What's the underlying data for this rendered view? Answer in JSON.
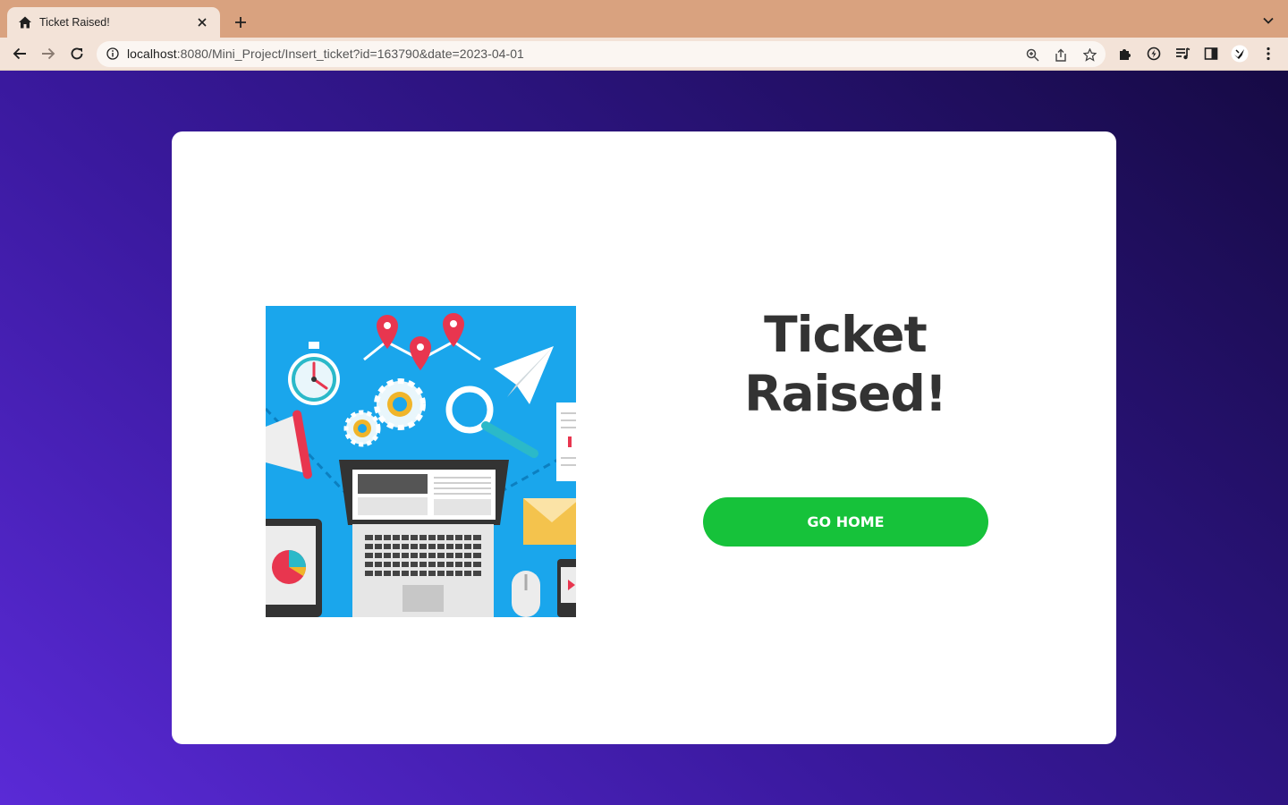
{
  "browser": {
    "tab_title": "Ticket Raised!",
    "url_host": "localhost",
    "url_rest": ":8080/Mini_Project/Insert_ticket?id=163790&date=2023-04-01"
  },
  "page": {
    "heading_line1": "Ticket",
    "heading_line2": "Raised!",
    "go_home_label": "GO HOME"
  },
  "colors": {
    "tab_strip": "#d9a27f",
    "toolbar": "#f3e3d8",
    "background_gradient_start": "#5a2ad6",
    "background_gradient_end": "#160a44",
    "button": "#16c23a",
    "heading": "#333333",
    "illustration_bg": "#1aa6ec"
  },
  "icons": {
    "favicon": "home-icon",
    "toolbar": [
      "back-arrow-icon",
      "forward-arrow-icon",
      "reload-icon",
      "info-icon",
      "zoom-icon",
      "share-icon",
      "star-icon",
      "puzzle-icon",
      "sync-icon",
      "media-icon",
      "side-panel-icon",
      "profile-icon",
      "kebab-menu-icon"
    ]
  }
}
